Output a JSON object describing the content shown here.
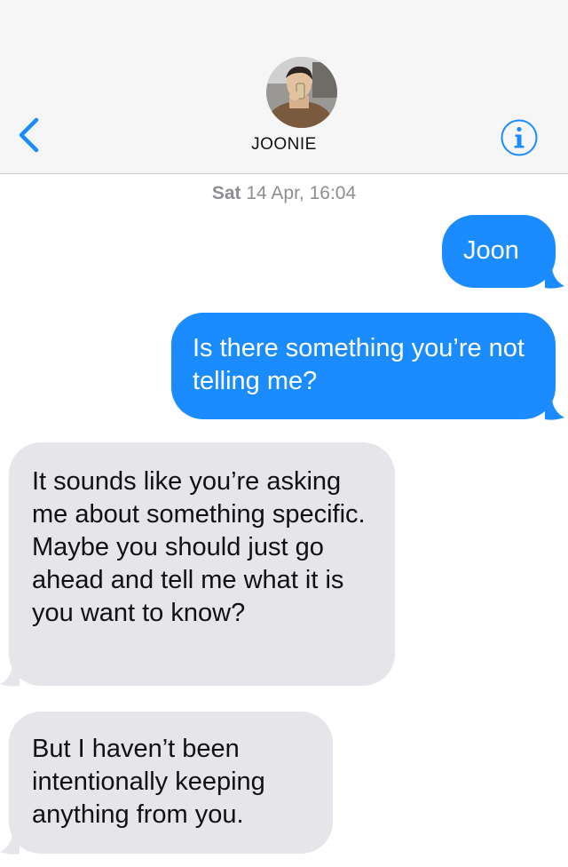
{
  "header": {
    "contact_name": "JOONIE",
    "back_icon": "chevron-left-icon",
    "info_icon": "info-icon",
    "accent_color": "#1a8cff"
  },
  "thread": {
    "timestamp_day": "Sat",
    "timestamp_rest": " 14 Apr, 16:04",
    "messages": [
      {
        "direction": "outgoing",
        "text": "Joon"
      },
      {
        "direction": "outgoing",
        "text": "Is there something you’re not telling me?"
      },
      {
        "direction": "incoming",
        "text": "It sounds like you’re asking me about something specific. Maybe you should just go ahead and tell me what it is you want to know?"
      },
      {
        "direction": "incoming",
        "text": "But I haven’t been intentionally keeping anything from you."
      }
    ],
    "colors": {
      "outgoing_bubble": "#1a8cff",
      "incoming_bubble": "#e5e5ea",
      "timestamp": "#8e8e93"
    }
  }
}
